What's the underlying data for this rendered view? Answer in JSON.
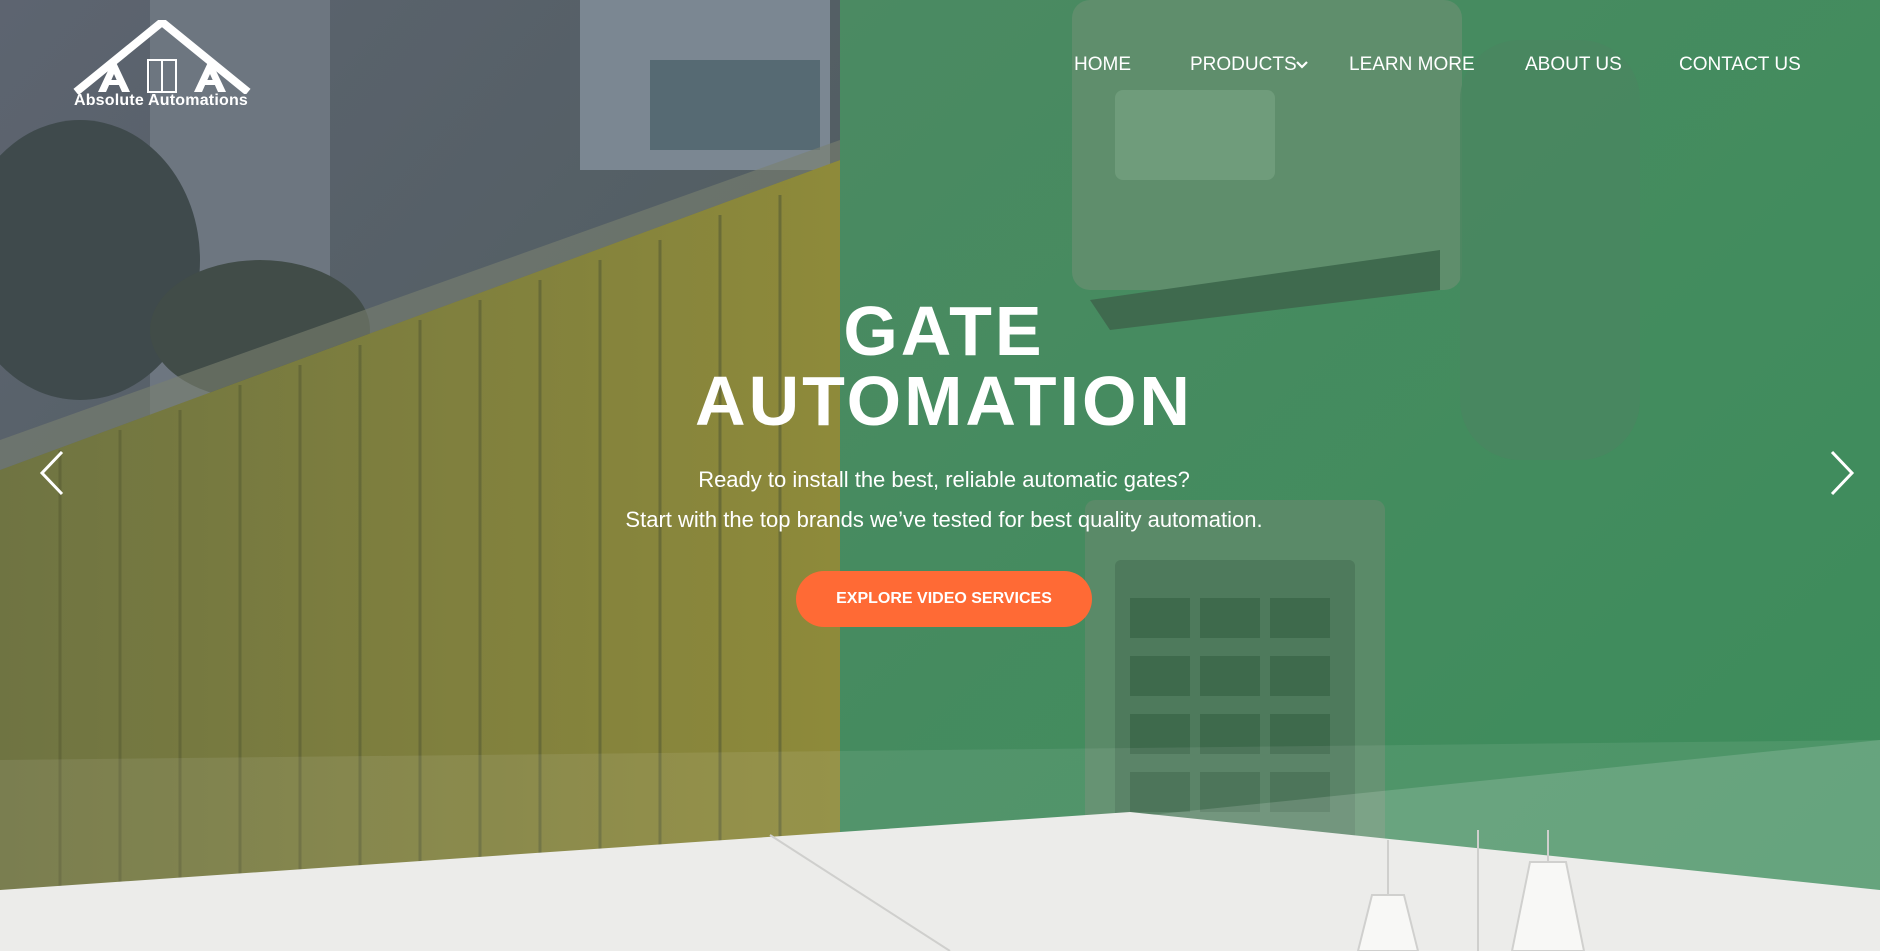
{
  "brand": {
    "name": "Absolute Automations",
    "logo_icon": "house-roof-logo-icon"
  },
  "nav": {
    "items": [
      {
        "label": "HOME"
      },
      {
        "label": "PRODUCTS",
        "has_dropdown": true
      },
      {
        "label": "LEARN MORE"
      },
      {
        "label": "ABOUT US"
      },
      {
        "label": "CONTACT US"
      }
    ],
    "dropdown_icon": "chevron-down-icon"
  },
  "hero": {
    "title_line1": "GATE",
    "title_line2": "AUTOMATION",
    "subtitle_line1": "Ready to install the best, reliable automatic gates?",
    "subtitle_line2": "Start with the top brands we’ve tested for best quality automation.",
    "cta_label": "EXPLORE VIDEO SERVICES",
    "prev_icon": "chevron-left-icon",
    "next_icon": "chevron-right-icon"
  },
  "colors": {
    "overlay_green": "#3f8f5f",
    "overlay_grey": "#5a6068",
    "gate_yellow": "#8a8a3c",
    "cta": "#ff6a35",
    "page_bg": "#ececea"
  }
}
